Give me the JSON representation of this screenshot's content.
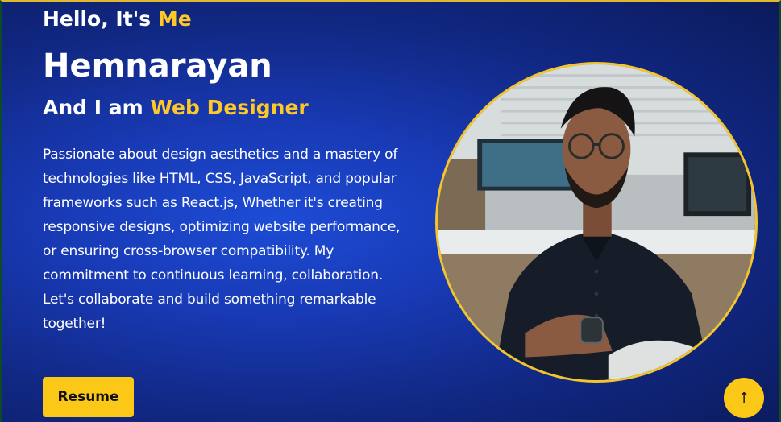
{
  "hero": {
    "greeting_prefix": "Hello, It's ",
    "greeting_accent": "Me",
    "name": "Hemnarayan",
    "role_prefix": "And I am ",
    "role_accent": "Web Designer",
    "bio_paragraph_1": "Passionate about design aesthetics and a mastery of technologies like HTML, CSS, JavaScript, and popular frameworks such as React.js, Whether it's creating responsive designs, optimizing website performance, or ensuring cross-browser compatibility. My commitment to continuous learning, collaboration.",
    "bio_paragraph_2": "Let's collaborate and build something remarkable together!",
    "resume_label": "Resume"
  },
  "scroll_top": {
    "icon": "arrow-up-icon",
    "glyph": "↑"
  },
  "colors": {
    "accent": "#ffc727",
    "button": "#fbc818",
    "background_center": "#1d4cd6",
    "background_edge": "#0b1a5a"
  }
}
